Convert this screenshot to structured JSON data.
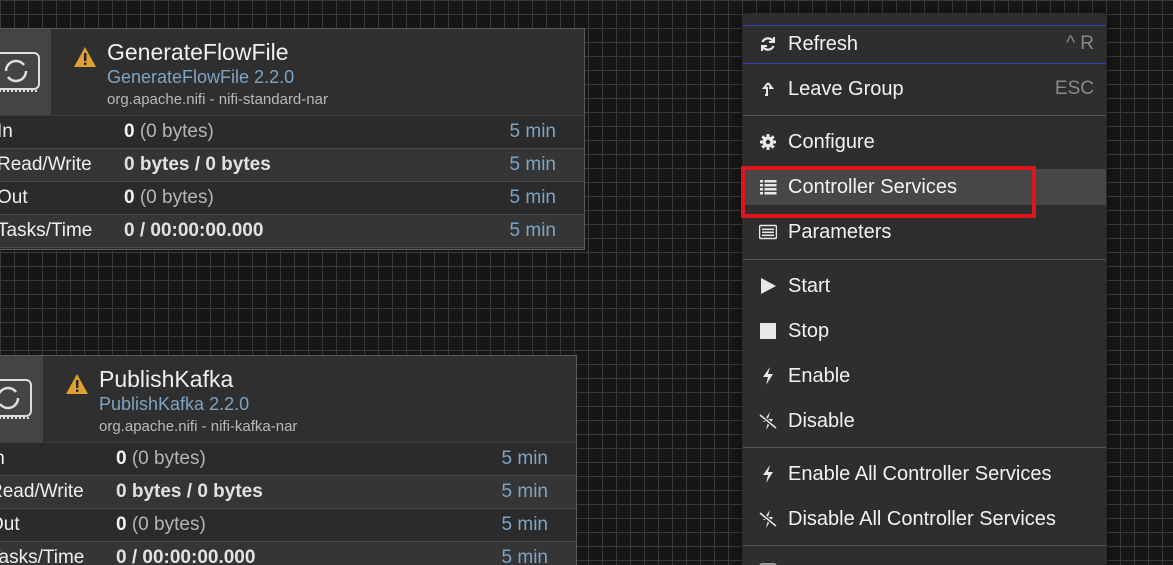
{
  "processors": [
    {
      "name": "GenerateFlowFile",
      "type": "GenerateFlowFile 2.2.0",
      "bundle": "org.apache.nifi - nifi-standard-nar",
      "stats": [
        {
          "label": "In",
          "value_main": "0",
          "value_rest": " (0 bytes)",
          "time": "5 min"
        },
        {
          "label": "Read/Write",
          "value": "0 bytes / 0 bytes",
          "time": "5 min"
        },
        {
          "label": "Out",
          "value_main": "0",
          "value_rest": " (0 bytes)",
          "time": "5 min"
        },
        {
          "label": "Tasks/Time",
          "value": "0 / 00:00:00.000",
          "time": "5 min"
        }
      ]
    },
    {
      "name": "PublishKafka",
      "type": "PublishKafka 2.2.0",
      "bundle": "org.apache.nifi - nifi-kafka-nar",
      "stats": [
        {
          "label": "In",
          "value_main": "0",
          "value_rest": " (0 bytes)",
          "time": "5 min"
        },
        {
          "label": "Read/Write",
          "value": "0 bytes / 0 bytes",
          "time": "5 min"
        },
        {
          "label": "Out",
          "value_main": "0",
          "value_rest": " (0 bytes)",
          "time": "5 min"
        },
        {
          "label": "Tasks/Time",
          "value": "0 / 00:00:00.000",
          "time": "5 min"
        }
      ]
    }
  ],
  "context_menu": {
    "refresh": {
      "label": "Refresh",
      "shortcut": "^ R",
      "icon": "refresh-icon"
    },
    "leave_group": {
      "label": "Leave Group",
      "shortcut": "ESC",
      "icon": "leave-group-icon"
    },
    "configure": {
      "label": "Configure",
      "icon": "gear-icon"
    },
    "controller_services": {
      "label": "Controller Services",
      "icon": "list-icon"
    },
    "parameters": {
      "label": "Parameters",
      "icon": "parameters-icon"
    },
    "start": {
      "label": "Start",
      "icon": "play-icon"
    },
    "stop": {
      "label": "Stop",
      "icon": "stop-icon"
    },
    "enable": {
      "label": "Enable",
      "icon": "bolt-icon"
    },
    "disable": {
      "label": "Disable",
      "icon": "bolt-off-icon"
    },
    "enable_all": {
      "label": "Enable All Controller Services",
      "icon": "bolt-icon"
    },
    "disable_all": {
      "label": "Disable All Controller Services",
      "icon": "bolt-off-icon"
    }
  },
  "colors": {
    "highlight": "#e0141b",
    "link_blue": "#7fa4c4",
    "warning": "#e0a030"
  }
}
